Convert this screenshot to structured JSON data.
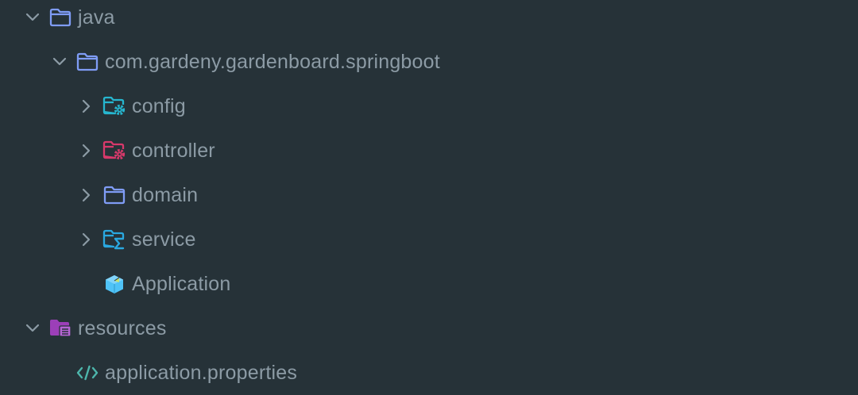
{
  "colors": {
    "background": "#263238",
    "text": "#8c9ba5",
    "folder_default": "#7f9cf5",
    "folder_config": "#26b6cf",
    "folder_controller": "#d8396b",
    "folder_service": "#2aa8e0",
    "folder_resources": "#9c3fb8",
    "application_icon": "#4fc3f7",
    "properties_icon": "#4db6ac"
  },
  "tree": {
    "items": [
      {
        "label": "java",
        "expanded": true,
        "icon": "folder-icon"
      },
      {
        "label": "com.gardeny.gardenboard.springboot",
        "expanded": true,
        "icon": "folder-icon"
      },
      {
        "label": "config",
        "expanded": false,
        "icon": "config-folder-icon"
      },
      {
        "label": "controller",
        "expanded": false,
        "icon": "controller-folder-icon"
      },
      {
        "label": "domain",
        "expanded": false,
        "icon": "folder-icon"
      },
      {
        "label": "service",
        "expanded": false,
        "icon": "service-folder-icon"
      },
      {
        "label": "Application",
        "icon": "spring-boot-application-icon"
      },
      {
        "label": "resources",
        "expanded": true,
        "icon": "resources-folder-icon"
      },
      {
        "label": "application.properties",
        "icon": "properties-file-icon"
      }
    ]
  }
}
